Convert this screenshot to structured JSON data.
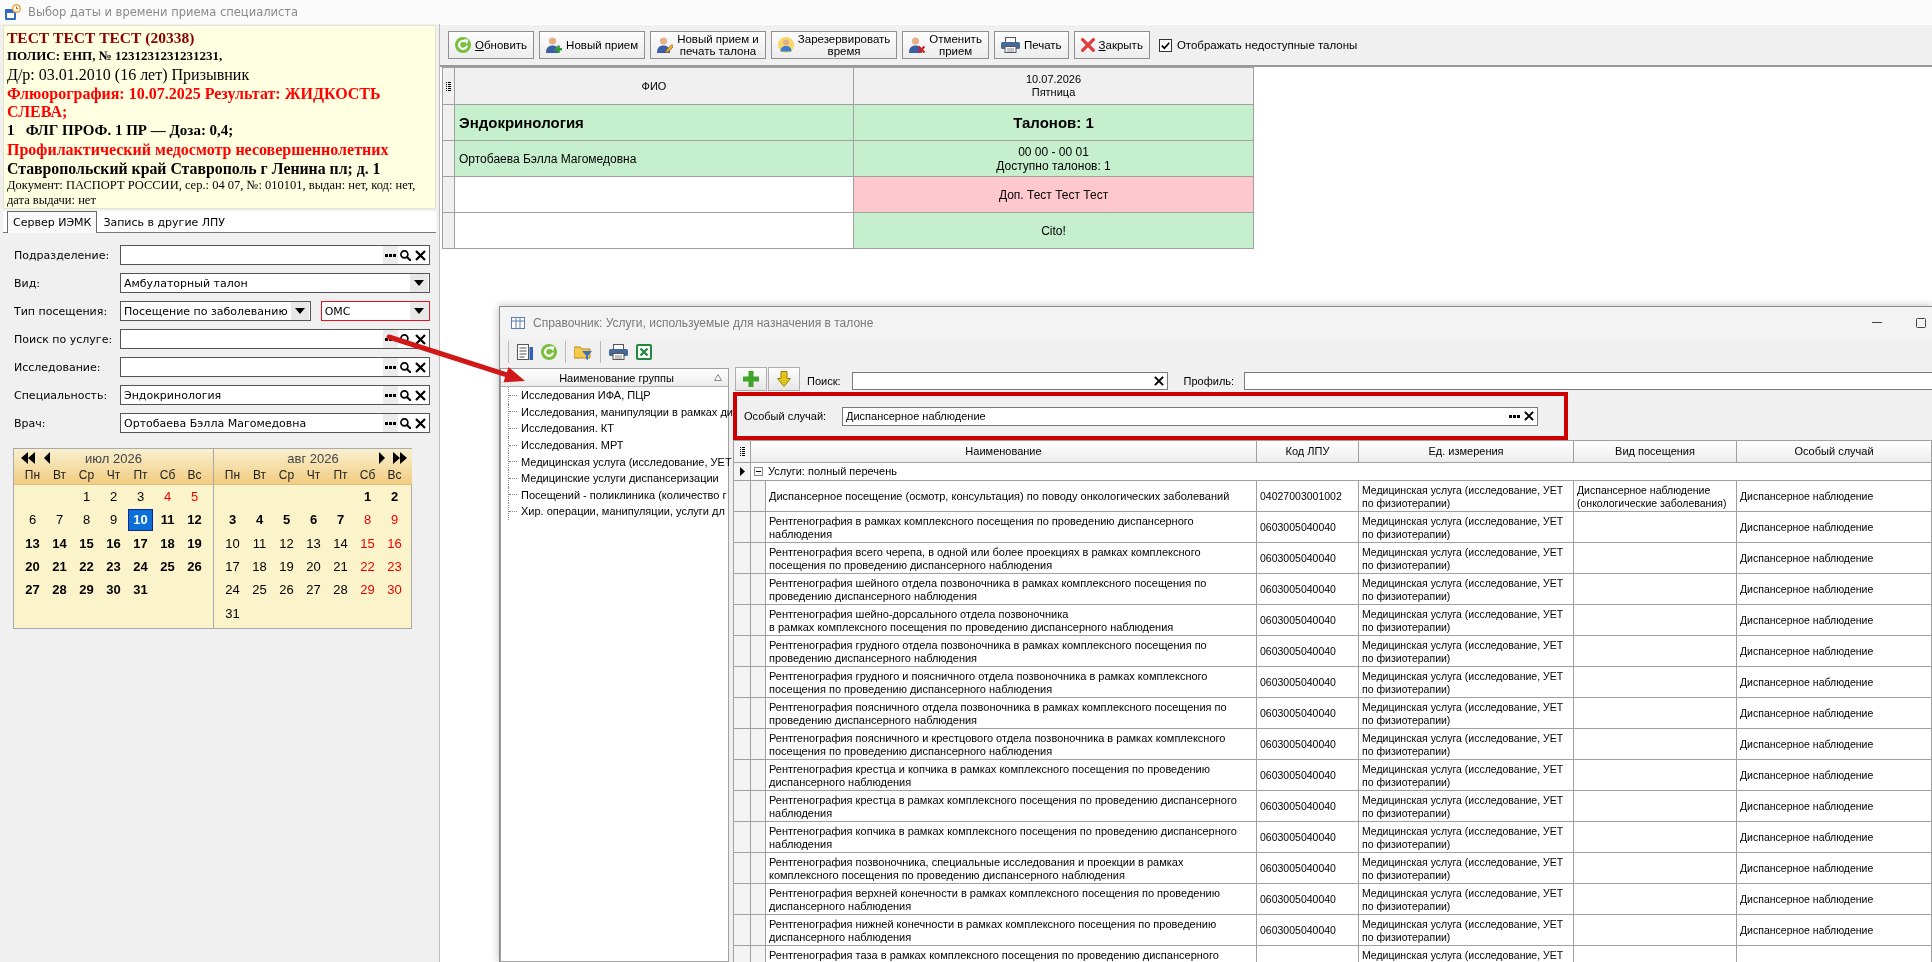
{
  "window": {
    "title": "Выбор даты и времени приема специалиста"
  },
  "patient": {
    "lines": [
      {
        "text": "ТЕСТ ТЕСТ ТЕСТ (20338)",
        "kind": "name"
      },
      {
        "text": "ПОЛИС: ЕНП, № 1231231231231231,",
        "kind": "policy"
      },
      {
        "text": "Д/р: 03.01.2010 (16 лет) Призывник",
        "kind": "plain"
      },
      {
        "text": "Флюорография: 10.07.2025 Результат: ЖИДКОСТЬ СЛЕВА;",
        "kind": "warning"
      },
      {
        "text": "1   ФЛГ ПРОФ. 1 ПР — Доза: 0,4;",
        "kind": "dose"
      },
      {
        "text": "Профилактический медосмотр несовершеннолетних",
        "kind": "alert"
      },
      {
        "text": "Ставропольский край Ставрополь г Ленина пл; д. 1",
        "kind": "address"
      },
      {
        "text": "Документ: ПАСПОРТ РОССИИ, сер.: 04 07, №: 010101, выдан: нет, код: нет, дата выдачи: нет",
        "kind": "note"
      }
    ]
  },
  "tabs": [
    {
      "label": "Сервер ИЭМК",
      "selected": true
    },
    {
      "label": "Запись в другие ЛПУ",
      "selected": false
    }
  ],
  "form": {
    "fields": [
      {
        "label": "Подразделение:",
        "controls": [
          {
            "kind": "lookup",
            "invalid": false
          }
        ]
      },
      {
        "label": "Вид:",
        "controls": [
          {
            "kind": "dropdown",
            "value": "Амбулаторный талон",
            "invalid": false
          }
        ]
      },
      {
        "label": "Тип посещения:",
        "controls": [
          {
            "kind": "dropdown",
            "value": "Посещение по заболеванию",
            "invalid": false
          },
          {
            "kind": "dropdown",
            "value": "ОМС",
            "invalid": true
          }
        ]
      },
      {
        "label": "Поиск по услуге:",
        "controls": [
          {
            "kind": "lookup",
            "invalid": false
          }
        ]
      },
      {
        "label": "Исследование:",
        "controls": [
          {
            "kind": "lookup",
            "invalid": false
          }
        ]
      },
      {
        "label": "Специальность:",
        "controls": [
          {
            "kind": "lookup",
            "value": "Эндокринология",
            "invalid": false
          }
        ]
      },
      {
        "label": "Врач:",
        "controls": [
          {
            "kind": "lookup",
            "value": "Ортобаева Бэлла Магомедовна",
            "invalid": false
          }
        ]
      }
    ]
  },
  "calendar": {
    "months": [
      {
        "title": "июл 2026",
        "weekdays": [
          "Пн",
          "Вт",
          "Ср",
          "Чт",
          "Пт",
          "Сб",
          "Вс"
        ],
        "weeks": [
          [
            {
              "d": "1",
              "kind": "regular",
              "selected": false
            },
            {
              "d": "2",
              "kind": "regular",
              "selected": false
            },
            {
              "d": "3",
              "kind": "regular",
              "selected": false
            },
            {
              "d": "4",
              "kind": "holiday",
              "selected": false
            },
            {
              "d": "5",
              "kind": "holiday",
              "selected": false
            }
          ],
          [
            {
              "d": "6",
              "kind": "regular",
              "selected": false
            },
            {
              "d": "7",
              "kind": "regular",
              "selected": false
            },
            {
              "d": "8",
              "kind": "regular",
              "selected": false
            },
            {
              "d": "9",
              "kind": "regular",
              "selected": false
            },
            {
              "d": "10",
              "kind": "open",
              "selected": true
            },
            {
              "d": "11",
              "kind": "open",
              "selected": false
            },
            {
              "d": "12",
              "kind": "open",
              "selected": false
            }
          ],
          [
            {
              "d": "13",
              "kind": "open",
              "selected": false
            },
            {
              "d": "14",
              "kind": "open",
              "selected": false
            },
            {
              "d": "15",
              "kind": "open",
              "selected": false
            },
            {
              "d": "16",
              "kind": "open",
              "selected": false
            },
            {
              "d": "17",
              "kind": "open",
              "selected": false
            },
            {
              "d": "18",
              "kind": "open",
              "selected": false
            },
            {
              "d": "19",
              "kind": "open",
              "selected": false
            }
          ],
          [
            {
              "d": "20",
              "kind": "open",
              "selected": false
            },
            {
              "d": "21",
              "kind": "open",
              "selected": false
            },
            {
              "d": "22",
              "kind": "open",
              "selected": false
            },
            {
              "d": "23",
              "kind": "open",
              "selected": false
            },
            {
              "d": "24",
              "kind": "open",
              "selected": false
            },
            {
              "d": "25",
              "kind": "open",
              "selected": false
            },
            {
              "d": "26",
              "kind": "open",
              "selected": false
            }
          ],
          [
            {
              "d": "27",
              "kind": "open",
              "selected": false
            },
            {
              "d": "28",
              "kind": "open",
              "selected": false
            },
            {
              "d": "29",
              "kind": "open",
              "selected": false
            },
            {
              "d": "30",
              "kind": "open",
              "selected": false
            },
            {
              "d": "31",
              "kind": "open",
              "selected": false
            }
          ]
        ]
      },
      {
        "title": "авг 2026",
        "weekdays": [
          "Пн",
          "Вт",
          "Ср",
          "Чт",
          "Пт",
          "Сб",
          "Вс"
        ],
        "weeks": [
          [
            {
              "d": "1",
              "kind": "open",
              "selected": false
            },
            {
              "d": "2",
              "kind": "open",
              "selected": false
            }
          ],
          [
            {
              "d": "3",
              "kind": "open",
              "selected": false
            },
            {
              "d": "4",
              "kind": "open",
              "selected": false
            },
            {
              "d": "5",
              "kind": "open",
              "selected": false
            },
            {
              "d": "6",
              "kind": "open",
              "selected": false
            },
            {
              "d": "7",
              "kind": "open",
              "selected": false
            },
            {
              "d": "8",
              "kind": "holiday",
              "selected": false
            },
            {
              "d": "9",
              "kind": "holiday",
              "selected": false
            }
          ],
          [
            {
              "d": "10",
              "kind": "regular",
              "selected": false
            },
            {
              "d": "11",
              "kind": "regular",
              "selected": false
            },
            {
              "d": "12",
              "kind": "regular",
              "selected": false
            },
            {
              "d": "13",
              "kind": "regular",
              "selected": false
            },
            {
              "d": "14",
              "kind": "regular",
              "selected": false
            },
            {
              "d": "15",
              "kind": "holiday",
              "selected": false
            },
            {
              "d": "16",
              "kind": "holiday",
              "selected": false
            }
          ],
          [
            {
              "d": "17",
              "kind": "regular",
              "selected": false
            },
            {
              "d": "18",
              "kind": "regular",
              "selected": false
            },
            {
              "d": "19",
              "kind": "regular",
              "selected": false
            },
            {
              "d": "20",
              "kind": "regular",
              "selected": false
            },
            {
              "d": "21",
              "kind": "regular",
              "selected": false
            },
            {
              "d": "22",
              "kind": "holiday",
              "selected": false
            },
            {
              "d": "23",
              "kind": "holiday",
              "selected": false
            }
          ],
          [
            {
              "d": "24",
              "kind": "regular",
              "selected": false
            },
            {
              "d": "25",
              "kind": "regular",
              "selected": false
            },
            {
              "d": "26",
              "kind": "regular",
              "selected": false
            },
            {
              "d": "27",
              "kind": "regular",
              "selected": false
            },
            {
              "d": "28",
              "kind": "regular",
              "selected": false
            },
            {
              "d": "29",
              "kind": "holiday",
              "selected": false
            },
            {
              "d": "30",
              "kind": "holiday",
              "selected": false
            }
          ],
          [
            {
              "d": "31",
              "kind": "regular",
              "selected": false
            }
          ]
        ]
      }
    ]
  },
  "toolbar": {
    "buttons": [
      {
        "label": "Обновить",
        "mnemonic": true
      },
      {
        "label": "Новый прием",
        "mnemonic": false
      },
      {
        "label": "Новый прием и\nпечать талона",
        "mnemonic": false
      },
      {
        "label": "Зарезервировать\nвремя",
        "mnemonic": false
      },
      {
        "label": "Отменить\nприем",
        "mnemonic": false
      },
      {
        "label": "Печать",
        "mnemonic": false
      },
      {
        "label": "Закрыть",
        "mnemonic": true
      }
    ],
    "show_unavailable": {
      "label": "Отображать недоступные талоны",
      "checked": true
    }
  },
  "schedule": {
    "columns": [
      {
        "label": "ФИО"
      },
      {
        "label": "10.07.2026",
        "sublabel": "Пятница"
      }
    ],
    "rows": [
      {
        "kind": "section",
        "cells": [
          {
            "lines": [
              "Эндокринология"
            ],
            "color": "#c6efce"
          },
          {
            "lines": [
              "Талонов: 1"
            ],
            "color": "#c6efce"
          }
        ]
      },
      {
        "kind": "doctor",
        "cells": [
          {
            "lines": [
              "Ортобаева Бэлла Магомедовна"
            ],
            "color": "#c6efce"
          },
          {
            "lines": [
              "00 00 - 00 01",
              "Доступно талонов: 1"
            ],
            "color": "#c6efce"
          }
        ]
      },
      {
        "kind": "slot",
        "cells": [
          {},
          {
            "lines": [
              "Доп. Тест Тест Тест"
            ],
            "color": "#ffc7ce"
          }
        ]
      },
      {
        "kind": "slot",
        "cells": [
          {},
          {
            "lines": [
              "Cito!"
            ],
            "color": "#c6efce"
          }
        ]
      }
    ]
  },
  "dialog": {
    "title": "Справочник: Услуги, используемые для назначения в талоне",
    "groups": {
      "header": "Наименование группы",
      "items": [
        "Исследования ИФА, ПЦР",
        "Исследования, манипуляции в рамках ди",
        "Исследования. КТ",
        "Исследования. МРТ",
        "Медицинская услуга (исследование, УЕТ",
        "Медицинские услуги диспансеризации",
        "Посещений - поликлиника (количество г",
        "Хир. операции, манипуляции, услуги дл"
      ]
    },
    "search": {
      "label": "Поиск:"
    },
    "profile": {
      "label": "Профиль:"
    },
    "special_case": {
      "label": "Особый случай:",
      "value": "Диспансерное наблюдение"
    },
    "table": {
      "columns": [
        "Наименование",
        "Код ЛПУ",
        "Ед. измерения",
        "Вид посещения",
        "Особый случай"
      ],
      "group": {
        "label": "Услуги: полный перечень",
        "expanded": true,
        "current": true
      },
      "rows": [
        {
          "name": "Диспансерное посещение (осмотр, консультация) по поводу онкологических заболеваний",
          "code": "04027003001002",
          "unit": "Медицинская услуга (исследование, УЕТ по физиотерапии)",
          "visit_type": "Диспансерное наблюдение (онкологические заболевания)",
          "special_case": "Диспансерное наблюдение"
        },
        {
          "name": "Рентгенография в рамках комплексного посещения по проведению диспансерного наблюдения",
          "code": "0603005040040",
          "unit": "Медицинская услуга (исследование, УЕТ по физиотерапии)",
          "special_case": "Диспансерное наблюдение"
        },
        {
          "name": "Рентгенография всего черепа, в одной или более проекциях в рамках комплексного посещения по проведению диспансерного наблюдения",
          "code": "0603005040040",
          "unit": "Медицинская услуга (исследование, УЕТ по физиотерапии)",
          "special_case": "Диспансерное наблюдение"
        },
        {
          "name": "Рентгенография шейного отдела позвоночника в рамках комплексного посещения по проведению диспансерного наблюдения",
          "code": "0603005040040",
          "unit": "Медицинская услуга (исследование, УЕТ по физиотерапии)",
          "special_case": "Диспансерное наблюдение"
        },
        {
          "name": "Рентгенография шейно-дорсального отдела позвоночника\nв рамках комплексного посещения по проведению диспансерного наблюдения",
          "code": "0603005040040",
          "unit": "Медицинская услуга (исследование, УЕТ по физиотерапии)",
          "special_case": "Диспансерное наблюдение"
        },
        {
          "name": "Рентгенография грудного отдела позвоночника в рамках комплексного посещения по проведению диспансерного наблюдения",
          "code": "0603005040040",
          "unit": "Медицинская услуга (исследование, УЕТ по физиотерапии)",
          "special_case": "Диспансерное наблюдение"
        },
        {
          "name": "Рентгенография грудного и поясничного отдела позвоночника в рамках комплексного посещения по проведению диспансерного наблюдения",
          "code": "0603005040040",
          "unit": "Медицинская услуга (исследование, УЕТ по физиотерапии)",
          "special_case": "Диспансерное наблюдение"
        },
        {
          "name": "Рентгенография поясничного отдела позвоночника в рамках комплексного посещения по проведению диспансерного наблюдения",
          "code": "0603005040040",
          "unit": "Медицинская услуга (исследование, УЕТ по физиотерапии)",
          "special_case": "Диспансерное наблюдение"
        },
        {
          "name": "Рентгенография поясничного и крестцового отдела позвоночника в рамках комплексного посещения по проведению диспансерного наблюдения",
          "code": "0603005040040",
          "unit": "Медицинская услуга (исследование, УЕТ по физиотерапии)",
          "special_case": "Диспансерное наблюдение"
        },
        {
          "name": "Рентгенография крестца и копчика в рамках комплексного посещения по проведению диспансерного наблюдения",
          "code": "0603005040040",
          "unit": "Медицинская услуга (исследование, УЕТ по физиотерапии)",
          "special_case": "Диспансерное наблюдение"
        },
        {
          "name": "Рентгенография крестца в рамках комплексного посещения по проведению диспансерного наблюдения",
          "code": "0603005040040",
          "unit": "Медицинская услуга (исследование, УЕТ по физиотерапии)",
          "special_case": "Диспансерное наблюдение"
        },
        {
          "name": "Рентгенография копчика в рамках комплексного посещения по проведению диспансерного наблюдения",
          "code": "0603005040040",
          "unit": "Медицинская услуга (исследование, УЕТ по физиотерапии)",
          "special_case": "Диспансерное наблюдение"
        },
        {
          "name": "Рентгенография позвоночника, специальные исследования и проекции в рамках комплексного посещения по проведению диспансерного наблюдения",
          "code": "0603005040040",
          "unit": "Медицинская услуга (исследование, УЕТ по физиотерапии)",
          "special_case": "Диспансерное наблюдение"
        },
        {
          "name": "Рентгенография верхней конечности в рамках комплексного посещения по проведению диспансерного наблюдения",
          "code": "0603005040040",
          "unit": "Медицинская услуга (исследование, УЕТ по физиотерапии)",
          "special_case": "Диспансерное наблюдение"
        },
        {
          "name": "Рентгенография нижней конечности в рамках комплексного посещения по проведению диспансерного наблюдения",
          "code": "0603005040040",
          "unit": "Медицинская услуга (исследование, УЕТ по физиотерапии)",
          "special_case": "Диспансерное наблюдение"
        },
        {
          "name": "Рентгенография таза в рамках комплексного посещения по проведению диспансерного",
          "unit": "Медицинская услуга (исследование, УЕТ"
        }
      ]
    }
  }
}
